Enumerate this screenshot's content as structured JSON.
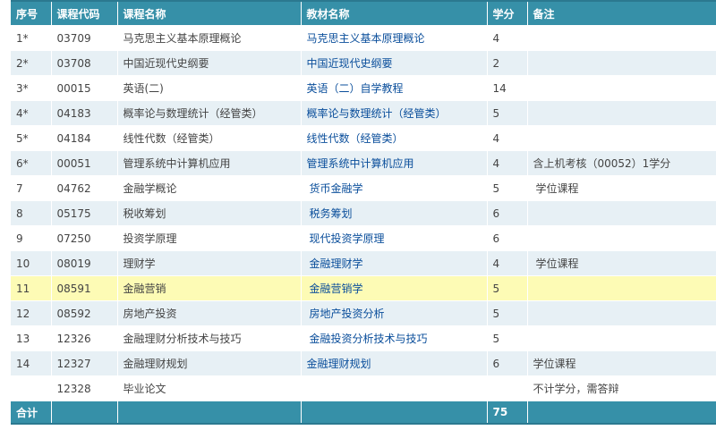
{
  "table": {
    "headers": [
      "序号",
      "课程代码",
      "课程名称",
      "教材名称",
      "学分",
      "备注"
    ],
    "rows": [
      {
        "no": "1*",
        "code": "03709",
        "name": "马克思主义基本原理概论",
        "book": "马克思主义基本原理概论",
        "credit": "4",
        "note": ""
      },
      {
        "no": "2*",
        "code": "03708",
        "name": "中国近现代史纲要",
        "book": "中国近现代史纲要",
        "credit": "2",
        "note": ""
      },
      {
        "no": "3*",
        "code": "00015",
        "name": "英语(二)",
        "book": "英语（二）自学教程",
        "credit": "14",
        "note": ""
      },
      {
        "no": "4*",
        "code": "04183",
        "name": "概率论与数理统计（经管类）",
        "book": "概率论与数理统计（经管类）",
        "credit": "5",
        "note": ""
      },
      {
        "no": "5*",
        "code": "04184",
        "name": "线性代数（经管类）",
        "book": "线性代数（经管类）",
        "credit": "4",
        "note": ""
      },
      {
        "no": "6*",
        "code": "00051",
        "name": "管理系统中计算机应用",
        "book": "管理系统中计算机应用",
        "credit": "4",
        "note": "含上机考核（00052）1学分"
      },
      {
        "no": "7",
        "code": "04762",
        "name": "金融学概论",
        "book": "货币金融学",
        "credit": "5",
        "note": "学位课程"
      },
      {
        "no": "8",
        "code": "05175",
        "name": "税收筹划",
        "book": "税务筹划",
        "credit": "6",
        "note": ""
      },
      {
        "no": "9",
        "code": "07250",
        "name": "投资学原理",
        "book": "现代投资学原理",
        "credit": "6",
        "note": ""
      },
      {
        "no": "10",
        "code": "08019",
        "name": "理财学",
        "book": "金融理财学",
        "credit": "4",
        "note": "学位课程"
      },
      {
        "no": "11",
        "code": "08591",
        "name": "金融营销",
        "book": "金融营销学",
        "credit": "5",
        "note": ""
      },
      {
        "no": "12",
        "code": "08592",
        "name": "房地产投资",
        "book": "房地产投资分析",
        "credit": "5",
        "note": ""
      },
      {
        "no": "13",
        "code": "12326",
        "name": "金融理财分析技术与技巧",
        "book": "金融投资分析技术与技巧",
        "credit": "5",
        "note": ""
      },
      {
        "no": "14",
        "code": "12327",
        "name": "金融理财规划",
        "book": "金融理财规划",
        "credit": "6",
        "note": "学位课程"
      },
      {
        "no": "",
        "code": "12328",
        "name": "毕业论文",
        "book": "",
        "credit": "",
        "note": "不计学分，需答辩"
      }
    ],
    "footer": {
      "label": "合计",
      "total_credit": "75"
    },
    "colors": {
      "header_bg": "#3690a8",
      "row_alt_bg": "#e7f0f5",
      "highlight_bg": "#fdfbb5",
      "book_link": "#0a4e9b"
    }
  }
}
